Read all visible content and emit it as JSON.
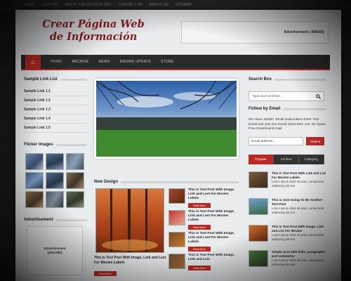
{
  "topbar": {
    "items": [
      "HOME",
      "CUSTOM",
      "ABOUT TRICKSTOUR.NET",
      "CONTACT US",
      "ABOUT US",
      "SITEMAP"
    ]
  },
  "header": {
    "logo_line1": "Crear Página Web",
    "logo_line2": "de Información",
    "ad_label": "Advertisement ( 468x60)"
  },
  "nav": {
    "home_icon": "home-icon",
    "items": [
      "HOME",
      "ARCHIVE",
      "NEWS",
      "ENGINE UPDATE",
      "STORE"
    ]
  },
  "sidebar_left": {
    "links_title": "Sample Link List",
    "links": [
      "Sample Link 1.1",
      "Sample Link 1.2",
      "Sample Link 1.3",
      "Sample Link 1.4",
      "Sample Link 1.5"
    ],
    "flickr_title": "Flicker Images",
    "ad_title": "Advertisement",
    "ad_label": "Advertisement",
    "ad_size": "(250x250)"
  },
  "main": {
    "new_design_title": "New Design",
    "big_post": {
      "title": "This is Test Post With Image, Link and Lest For Movies Labels",
      "button": "Read More"
    },
    "posts": [
      {
        "title": "This is Test Post With Image, Link and Lest For Movies Labels",
        "button": "Read More"
      },
      {
        "title": "This is Test Post With Image, Link and Lest For Movies Labels",
        "button": "Read More"
      },
      {
        "title": "This is Test Post With Image, Link and Lest For Movies Labels",
        "button": "Read More"
      },
      {
        "title": "This is Test Post With Image, Link and Lest",
        "button": "Read More"
      }
    ]
  },
  "sidebar_right": {
    "search_title": "Search Box",
    "search_placeholder": "Type and Hit Enter...",
    "search_icon": "search-icon",
    "follow_title": "Follow by Email",
    "follow_text": "We Have 10000+ Email Subscribers Enter Your Email and Join Our Email Subscriber List. No Spam Free Download E-mail",
    "email_placeholder": "Email address...",
    "submit_label": "Submit",
    "tabs": [
      "Popular",
      "Archive",
      "Category"
    ],
    "active_tab": "Popular",
    "posts": [
      {
        "title": "This is Test Post With Link and List For Movies Labels",
        "excerpt": "Lorem ipsum dolor sit amet, consectetur adipiscing elit sed"
      },
      {
        "title": "This is Just Going To Be Another Test Post",
        "excerpt": "Lorem ipsum dolor sit amet, consectetur adipiscing elit sed"
      },
      {
        "title": "This is Test Post With Image, Link and List For Movies",
        "excerpt": "Lorem ipsum dolor sit amet, consectetur adipiscing elit sed"
      },
      {
        "title": "Simple post with links, paragraphs and comments",
        "excerpt": "Lorem ipsum dolor sit amet, consectetur adipiscing elit sed"
      }
    ]
  },
  "colors": {
    "accent": "#b72a24",
    "logo": "#8a1e1e",
    "nav_bg": "#2a2a2a",
    "page_bg": "#e9ecee"
  }
}
